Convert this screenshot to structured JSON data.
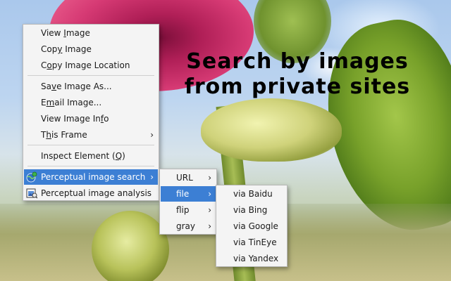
{
  "overlay_caption": {
    "line1": "Search by images",
    "line2": "from private sites"
  },
  "context_menu": {
    "items": [
      {
        "pre": "View ",
        "key": "I",
        "post": "mage"
      },
      {
        "pre": "Cop",
        "key": "y",
        "post": " Image"
      },
      {
        "pre": "C",
        "key": "o",
        "post": "py Image Location"
      },
      {
        "pre": "Sa",
        "key": "v",
        "post": "e Image As..."
      },
      {
        "pre": "E",
        "key": "m",
        "post": "ail Image..."
      },
      {
        "pre": "View Image In",
        "key": "f",
        "post": "o"
      },
      {
        "pre": "T",
        "key": "h",
        "post": "is Frame"
      },
      {
        "pre": "Inspect Element (",
        "key": "Q",
        "post": ")"
      },
      {
        "label": "Perceptual image search"
      },
      {
        "label": "Perceptual image analysis"
      }
    ],
    "submenu_arrow": "›"
  },
  "search_submenu": {
    "items": [
      "URL",
      "file",
      "flip",
      "gray"
    ]
  },
  "file_submenu": {
    "items": [
      "via Baidu",
      "via Bing",
      "via Google",
      "via TinEye",
      "via Yandex"
    ]
  },
  "colors": {
    "highlight": "#3c7fd4",
    "menu_bg": "#f4f4f4"
  }
}
